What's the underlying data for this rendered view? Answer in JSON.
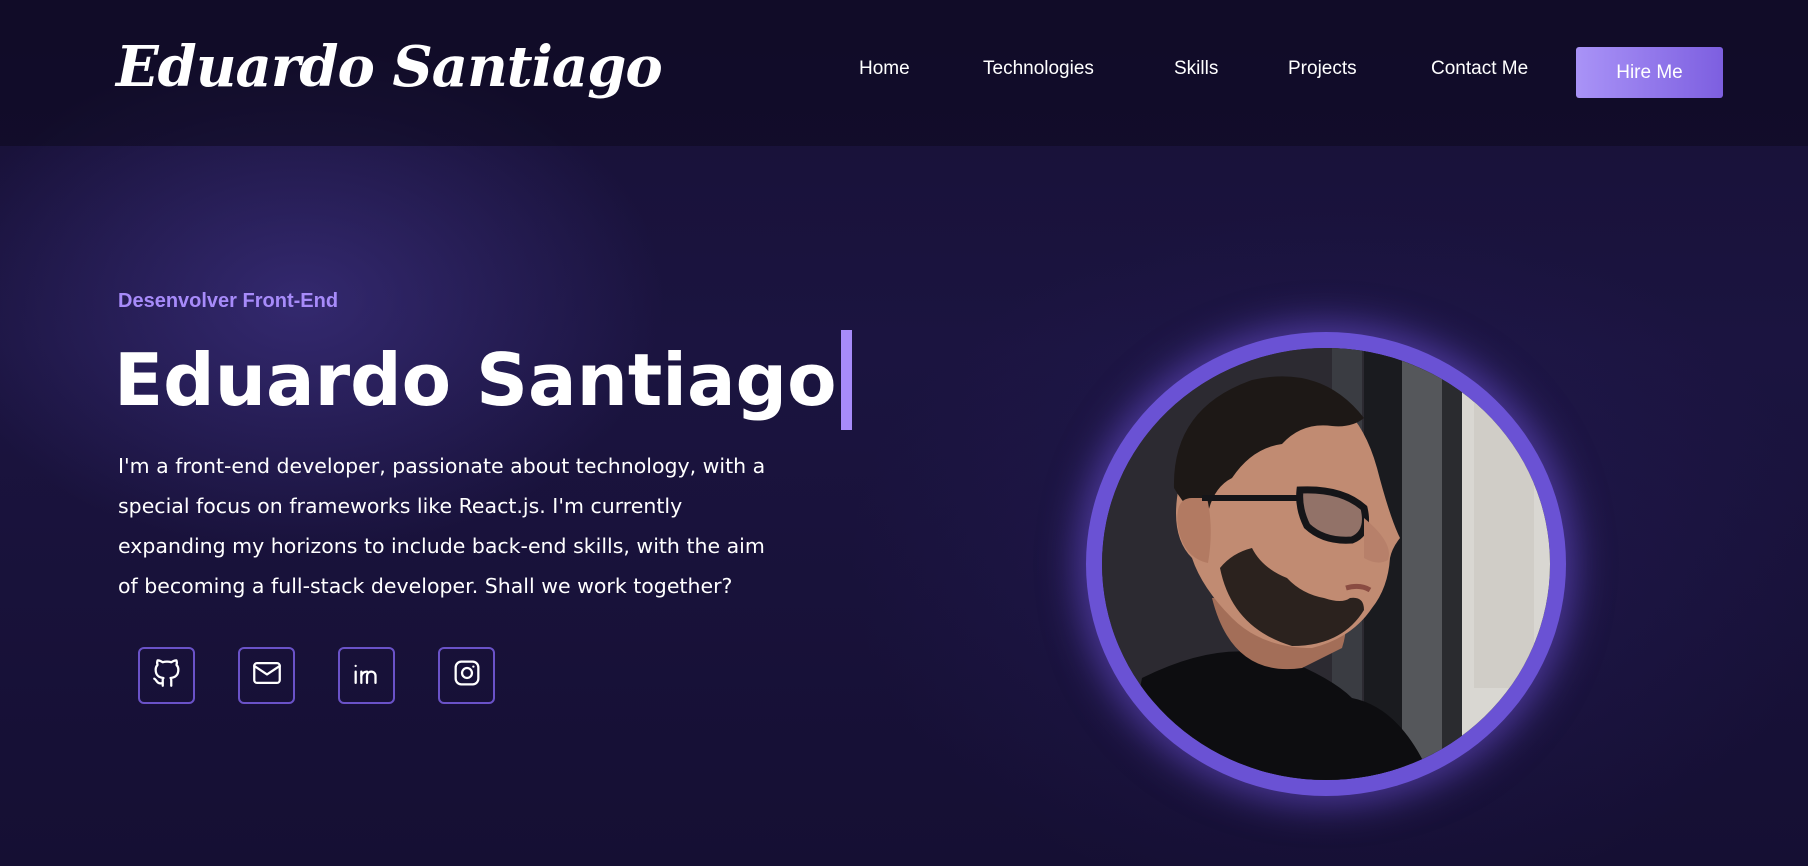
{
  "header": {
    "logo_text": "Eduardo Santiago",
    "nav": [
      {
        "label": "Home"
      },
      {
        "label": "Technologies"
      },
      {
        "label": "Skills"
      },
      {
        "label": "Projects"
      },
      {
        "label": "Contact Me"
      }
    ],
    "cta_label": "Hire Me"
  },
  "hero": {
    "subtitle": "Desenvolver Front-End",
    "title": "Eduardo Santiago",
    "bio": "I'm a front-end developer, passionate about technology, with a special focus on frameworks like React.js. I'm currently expanding my horizons to include back-end skills, with the aim of becoming a full-stack developer. Shall we work together?",
    "socials": [
      {
        "icon": "github-icon"
      },
      {
        "icon": "mail-icon"
      },
      {
        "icon": "linkedin-icon"
      },
      {
        "icon": "instagram-icon"
      }
    ]
  },
  "colors": {
    "background": "#150f33",
    "accent": "#a78bfa",
    "button_gradient_start": "#a993f7",
    "button_gradient_end": "#7d5fe0",
    "ring": "#6a52d4"
  }
}
